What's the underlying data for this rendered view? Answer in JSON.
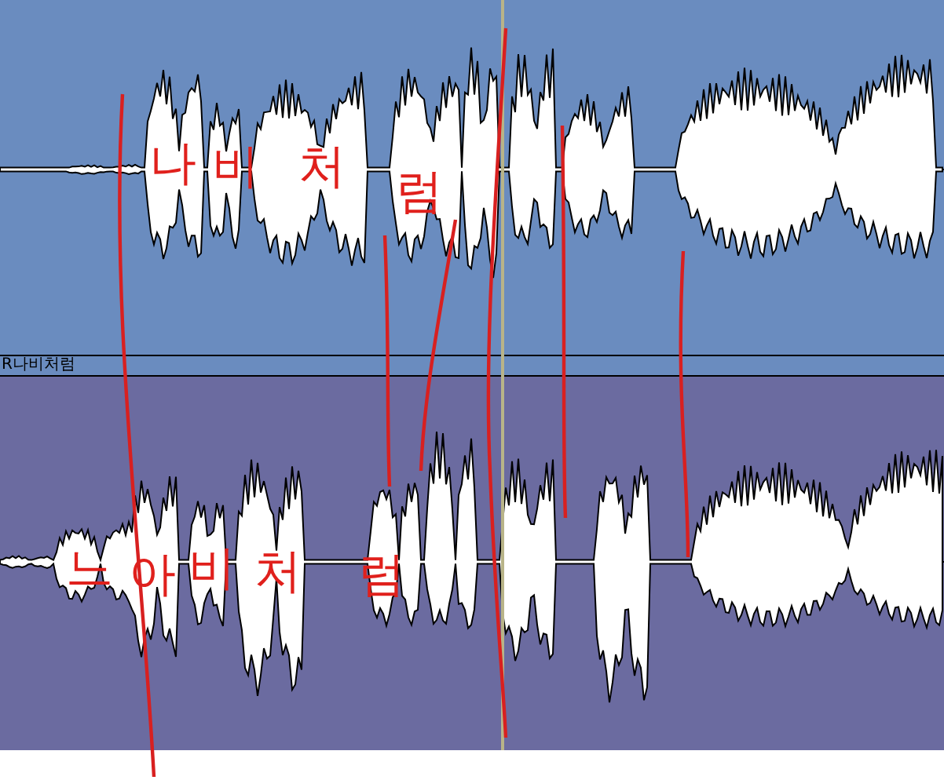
{
  "tracks": [
    {
      "color": "#6a8cbf",
      "annotations": [
        "나",
        "비",
        "처",
        "럼"
      ]
    },
    {
      "color": "#6b6ba0",
      "annotations": [
        "느",
        "아",
        "비",
        "처",
        "럼"
      ]
    }
  ],
  "track_label": "R나비처럼"
}
